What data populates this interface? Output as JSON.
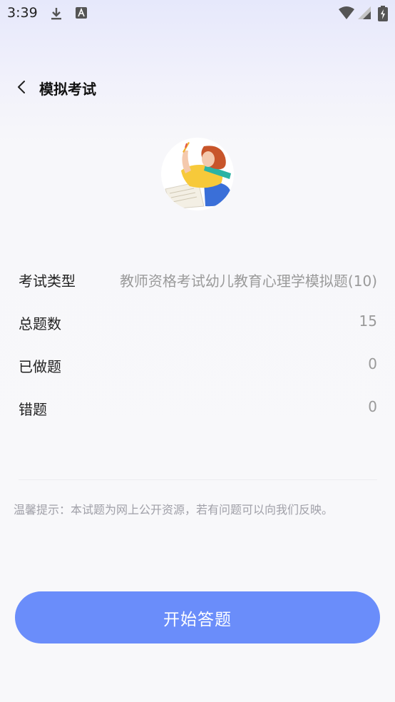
{
  "status_bar": {
    "time": "3:39",
    "icons": [
      "download-icon",
      "text-notification-icon",
      "wifi-icon",
      "signal-icon",
      "battery-icon"
    ]
  },
  "header": {
    "back_icon": "chevron-left-icon",
    "title": "模拟考试"
  },
  "illustration": "girl-studying-illustration",
  "info_rows": [
    {
      "label": "考试类型",
      "value": "教师资格考试幼儿教育心理学模拟题(10)"
    },
    {
      "label": "总题数",
      "value": "15"
    },
    {
      "label": "已做题",
      "value": "0"
    },
    {
      "label": "错题",
      "value": "0"
    }
  ],
  "hint": "温馨提示：本试题为网上公开资源，若有问题可以向我们反映。",
  "start_button": {
    "label": "开始答题"
  },
  "colors": {
    "accent": "#6a8dfa",
    "value_text": "#9a9a9a",
    "hint_text": "#a0a0a8"
  }
}
